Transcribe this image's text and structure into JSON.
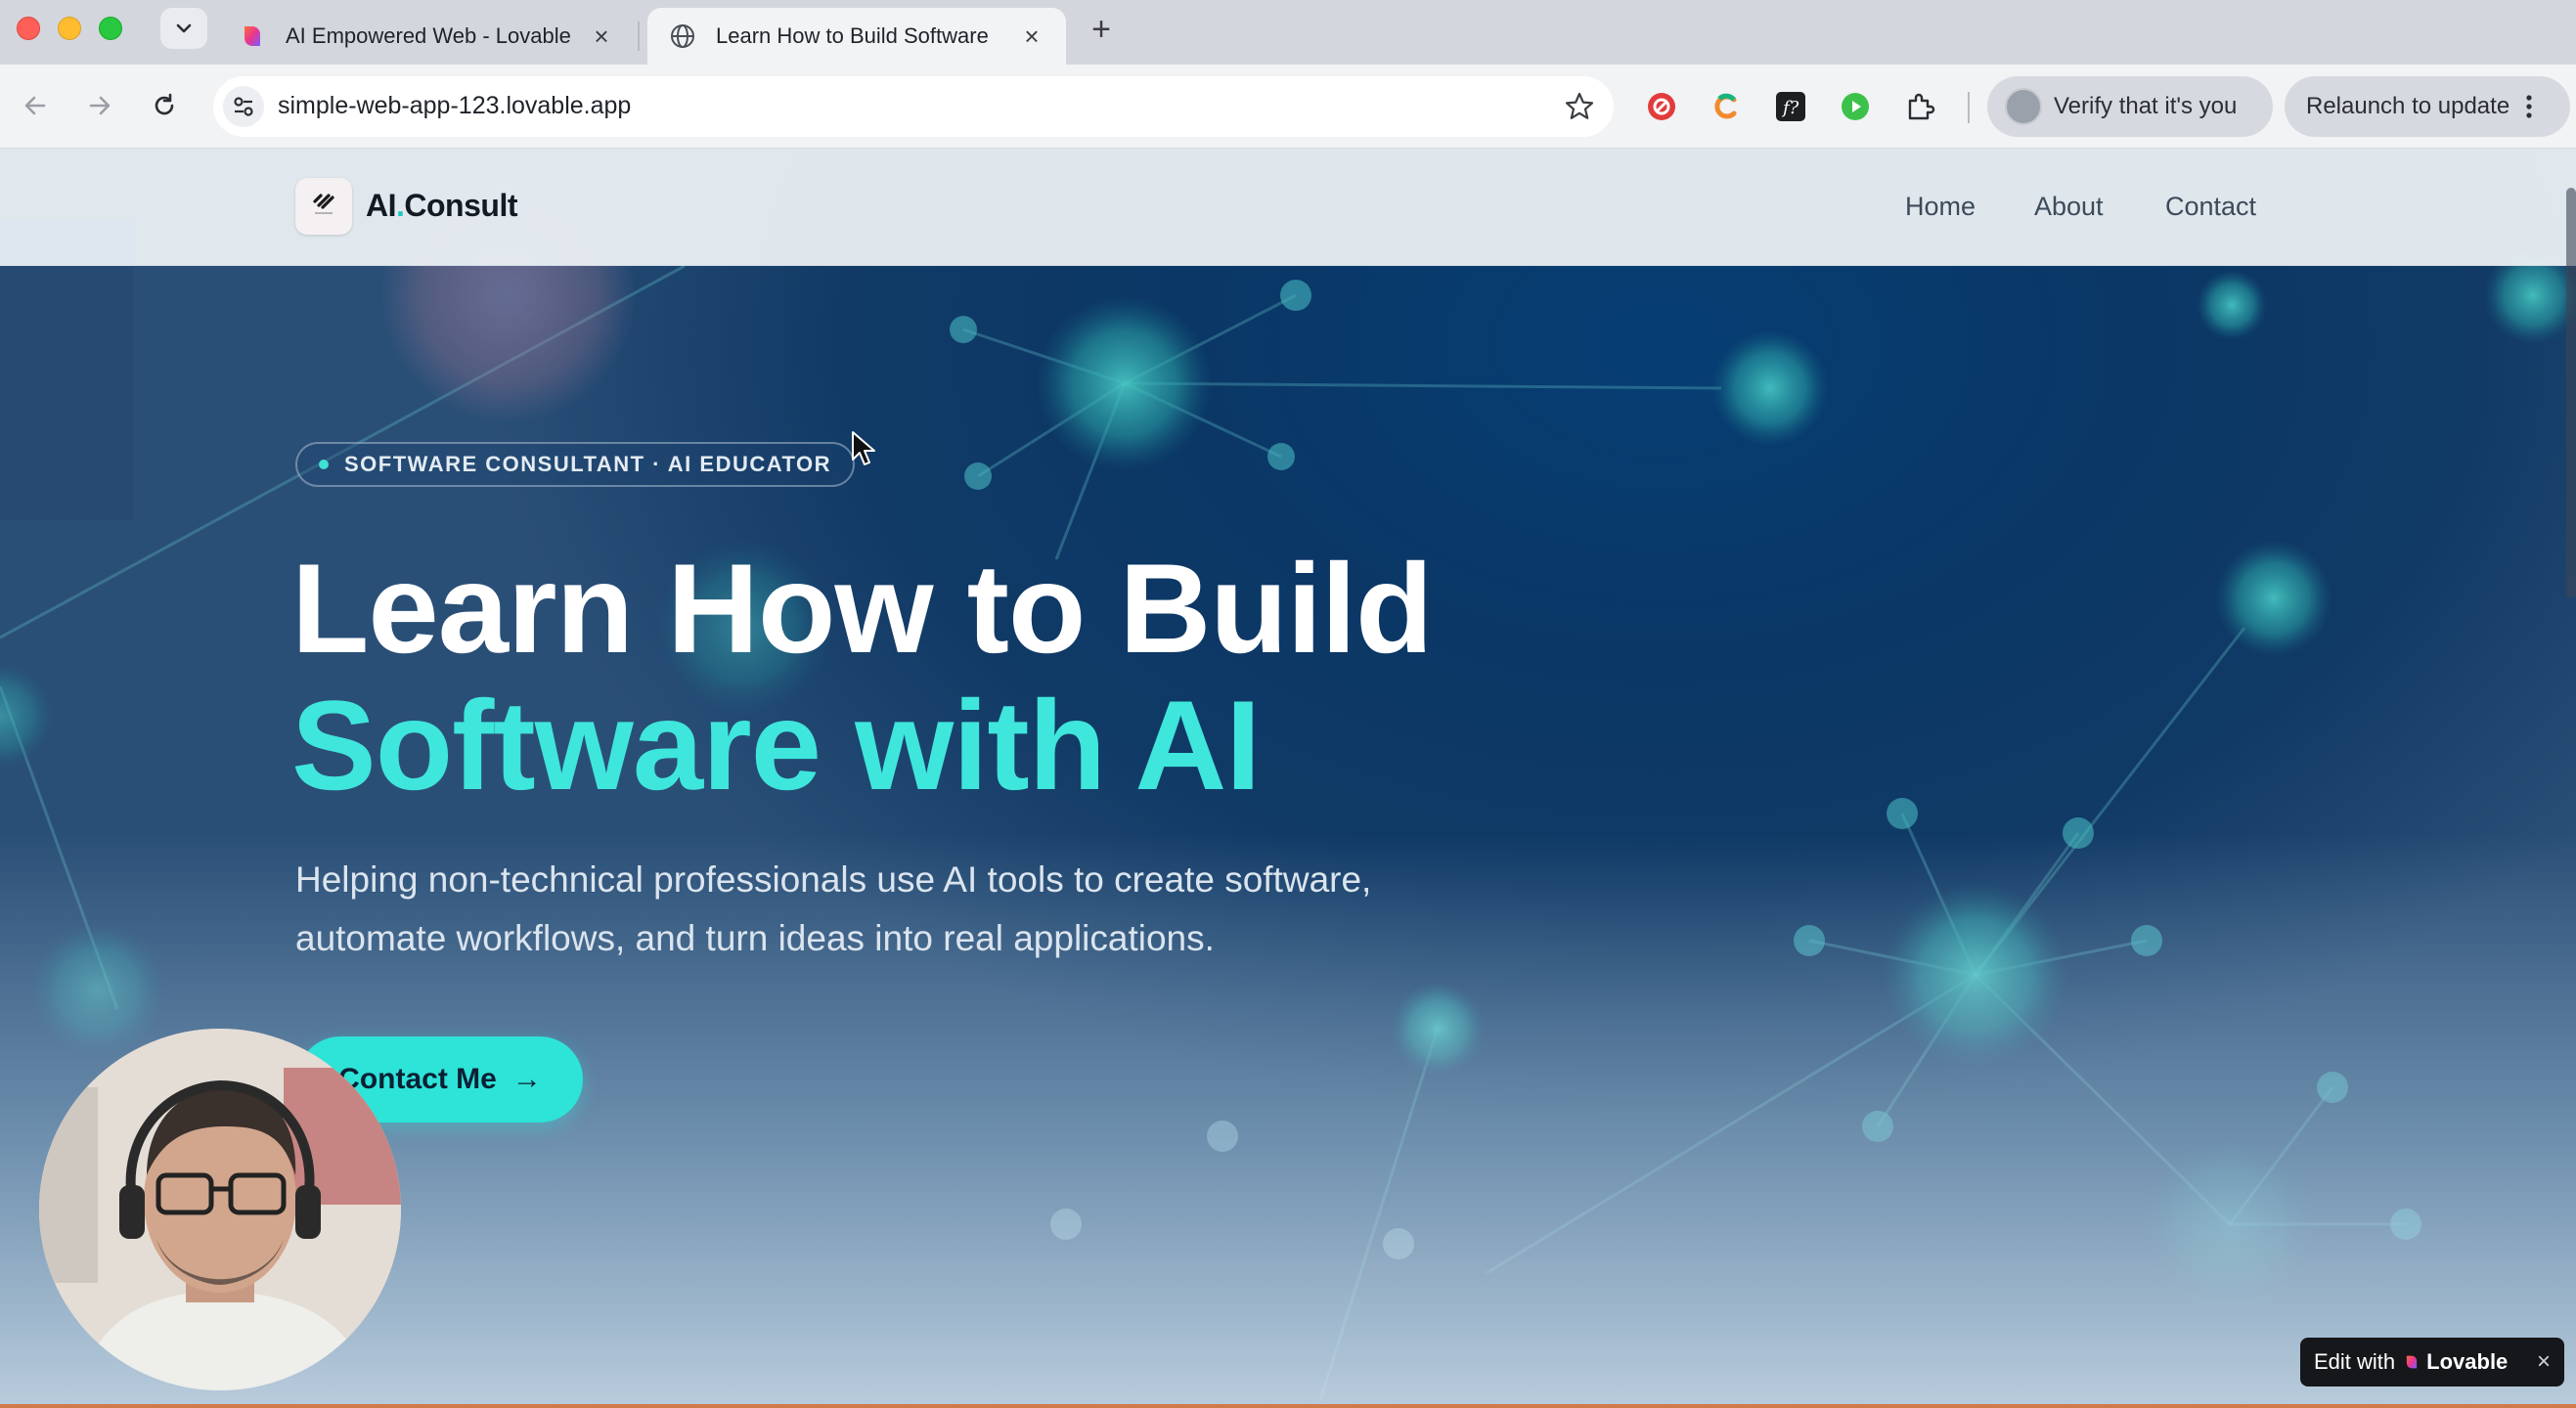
{
  "browser": {
    "tabs": [
      {
        "title": "AI Empowered Web - Lovable",
        "active": false,
        "favicon": "lovable-heart-icon"
      },
      {
        "title": "Learn How to Build Software",
        "active": true,
        "favicon": "globe-icon"
      }
    ],
    "url": "simple-web-app-123.lovable.app",
    "verify_label": "Verify that it's you",
    "relaunch_label": "Relaunch to update",
    "new_tab_symbol": "+",
    "close_symbol": "×"
  },
  "site": {
    "logo_prefix": "AI",
    "logo_dot": ".",
    "logo_suffix": "Consult",
    "nav": [
      "Home",
      "About",
      "Contact"
    ]
  },
  "hero": {
    "badge": "SOFTWARE CONSULTANT · AI EDUCATOR",
    "title_line1": "Learn How to Build",
    "title_line2": "Software with AI",
    "subtitle_line1": "Helping non-technical professionals use AI tools to create software,",
    "subtitle_line2": "automate workflows, and turn ideas into real applications.",
    "cta_label": "Contact Me",
    "cta_arrow": "→"
  },
  "lovable_chip": {
    "prefix": "Edit with",
    "brand": "Lovable",
    "close": "×"
  },
  "colors": {
    "accent": "#3fe6dc",
    "cta": "#2ee3d8",
    "hero_bg": "#0a3766"
  }
}
